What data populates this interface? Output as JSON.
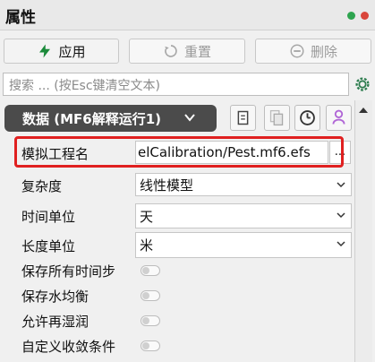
{
  "window": {
    "title": "属性"
  },
  "toolbar": {
    "apply_label": "应用",
    "reset_label": "重置",
    "delete_label": "删除"
  },
  "search": {
    "placeholder": "搜索 ... (按Esc键清空文本)"
  },
  "data_selector": {
    "label": "数据 (MF6解释运行1)"
  },
  "properties": {
    "model_project_name": {
      "label": "模拟工程名",
      "value": "elCalibration/Pest.mf6.efs",
      "browse": "..."
    },
    "complexity": {
      "label": "复杂度",
      "value": "线性模型"
    },
    "time_unit": {
      "label": "时间单位",
      "value": "天"
    },
    "length_unit": {
      "label": "长度单位",
      "value": "米"
    },
    "save_all_steps": {
      "label": "保存所有时间步"
    },
    "save_head_balance": {
      "label": "保存水均衡"
    },
    "allow_rewetting": {
      "label": "允许再湿润"
    },
    "custom_convergence": {
      "label": "自定义收敛条件"
    }
  },
  "icons": [
    "lightning-icon",
    "refresh-icon",
    "delete-icon",
    "gear-icon",
    "chevron-down-icon",
    "copy-icon",
    "paste-icon",
    "history-icon",
    "user-icon"
  ],
  "colors": {
    "accent_green": "#2ea44f",
    "highlight_red": "#e02020",
    "dark_pill": "#4b4b4b"
  }
}
